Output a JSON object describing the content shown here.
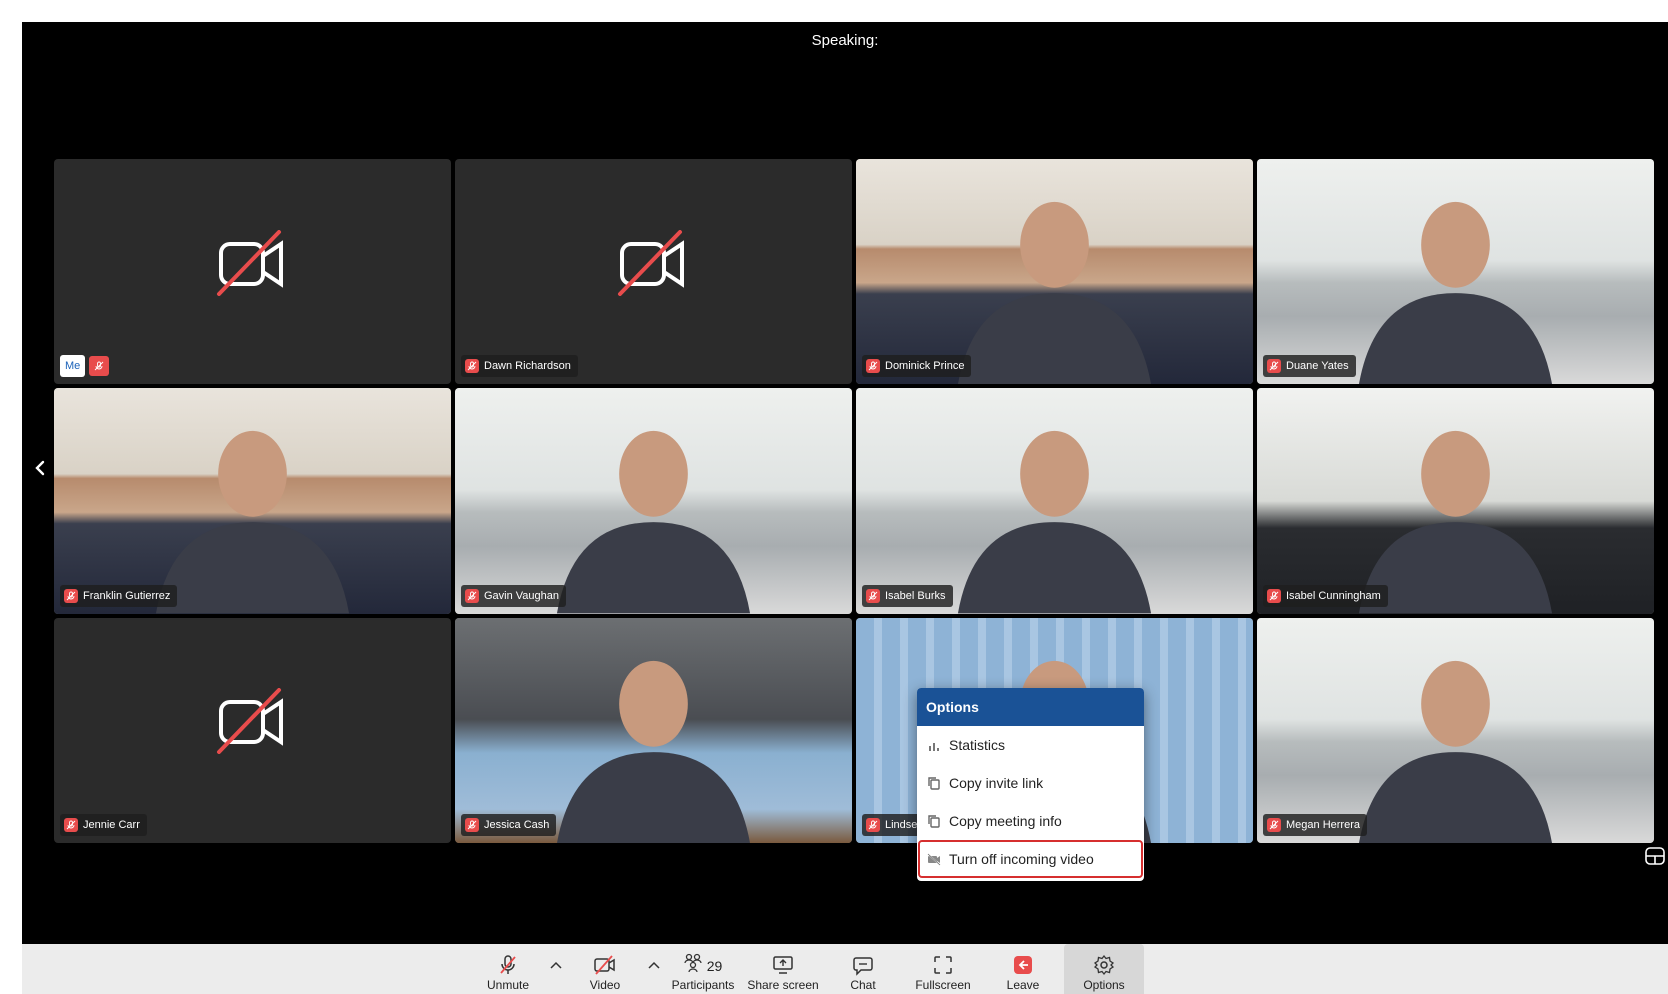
{
  "header": {
    "speaking_label": "Speaking:"
  },
  "tiles": [
    {
      "name": "",
      "is_me": true,
      "me_label": "Me",
      "video": false,
      "scene": ""
    },
    {
      "name": "Dawn Richardson",
      "video": false,
      "scene": ""
    },
    {
      "name": "Dominick Prince",
      "video": true,
      "scene": "bookshelf"
    },
    {
      "name": "Duane Yates",
      "video": true,
      "scene": "livingroom"
    },
    {
      "name": "Franklin Gutierrez",
      "video": true,
      "scene": "bookshelf"
    },
    {
      "name": "Gavin Vaughan",
      "video": true,
      "scene": "livingroom"
    },
    {
      "name": "Isabel Burks",
      "video": true,
      "scene": "livingroom"
    },
    {
      "name": "Isabel Cunningham",
      "video": true,
      "scene": "office"
    },
    {
      "name": "Jennie Carr",
      "video": false,
      "scene": ""
    },
    {
      "name": "Jessica Cash",
      "video": true,
      "scene": "library"
    },
    {
      "name": "Lindsey James",
      "video": true,
      "scene": "blinds"
    },
    {
      "name": "Megan Herrera",
      "video": true,
      "scene": "livingroom"
    }
  ],
  "options_menu": {
    "title": "Options",
    "items": [
      {
        "label": "Statistics",
        "icon": "bar-chart-icon"
      },
      {
        "label": "Copy invite link",
        "icon": "copy-icon"
      },
      {
        "label": "Copy meeting info",
        "icon": "copy-icon"
      },
      {
        "label": "Turn off incoming video",
        "icon": "video-off-icon",
        "highlighted": true
      }
    ]
  },
  "toolbar": {
    "unmute_label": "Unmute",
    "video_label": "Video",
    "participants_label": "Participants",
    "participants_count": "29",
    "share_label": "Share screen",
    "chat_label": "Chat",
    "fullscreen_label": "Fullscreen",
    "leave_label": "Leave",
    "options_label": "Options"
  },
  "colors": {
    "accent": "#1a5296",
    "mute_red": "#e84c4c",
    "tile_bg": "#2b2b2b",
    "highlight_border": "#d62f2f"
  }
}
